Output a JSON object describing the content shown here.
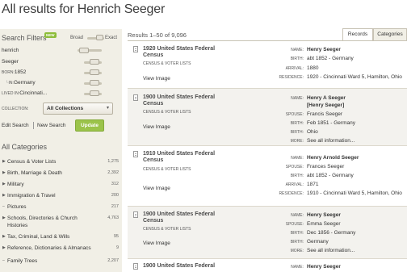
{
  "page": {
    "title": "All results for Henrich Seeger"
  },
  "sidebar": {
    "filters_title": "Search Filters",
    "new_badge": "NEW",
    "broad_label": "Broad",
    "exact_label": "Exact",
    "first_name": "henrich",
    "last_name": "Seeger",
    "born_label": "BORN:",
    "born_value": "1852",
    "born_in_label": "IN:",
    "born_in_value": "Germany",
    "lived_label": "LIVED IN:",
    "lived_value": "Cincinnati...",
    "collection_label": "COLLECTION:",
    "collection_value": "All Collections",
    "edit_search": "Edit Search",
    "new_search": "New Search",
    "update": "Update",
    "categories_title": "All Categories",
    "categories": [
      {
        "label": "Census & Voter Lists",
        "count": "1,275",
        "expandable": true
      },
      {
        "label": "Birth, Marriage & Death",
        "count": "2,392",
        "expandable": true
      },
      {
        "label": "Military",
        "count": "312",
        "expandable": true
      },
      {
        "label": "Immigration & Travel",
        "count": "200",
        "expandable": true
      },
      {
        "label": "Pictures",
        "count": "217",
        "expandable": false
      },
      {
        "label": "Schools, Directories & Church Histories",
        "count": "4,763",
        "expandable": true
      },
      {
        "label": "Tax, Criminal, Land & Wills",
        "count": "95",
        "expandable": true
      },
      {
        "label": "Reference, Dictionaries & Almanacs",
        "count": "9",
        "expandable": true
      },
      {
        "label": "Family Trees",
        "count": "2,207",
        "expandable": false
      }
    ]
  },
  "main": {
    "results_count": "Results 1–50 of 9,096",
    "tabs": {
      "records": "Records",
      "categories": "Categories"
    },
    "records": [
      {
        "title_line1": "1920 United States Federal",
        "title_line2": "Census",
        "subtitle": "CENSUS & VOTER LISTS",
        "view": "View Image",
        "fields": [
          {
            "label": "NAME:",
            "value": "Henry Seeger"
          },
          {
            "label": "BIRTH:",
            "value": "abt 1852 - Germany"
          },
          {
            "label": "ARRIVAL:",
            "value": "1880"
          },
          {
            "label": "RESIDENCE:",
            "value": "1920 - Cincinnati Ward 5, Hamilton, Ohio"
          }
        ]
      },
      {
        "title_line1": "1900 United States Federal",
        "title_line2": "Census",
        "subtitle": "CENSUS & VOTER LISTS",
        "view": "View Image",
        "fields": [
          {
            "label": "NAME:",
            "value": "Henry A Seeger"
          },
          {
            "label": "",
            "value": "[Henry Seeger]"
          },
          {
            "label": "SPOUSE:",
            "value": "Francis Seeger"
          },
          {
            "label": "BIRTH:",
            "value": "Feb 1851 - Germany"
          },
          {
            "label": "BIRTH:",
            "value": "Ohio"
          },
          {
            "label": "MORE:",
            "value": "See all information..."
          }
        ]
      },
      {
        "title_line1": "1910 United States Federal",
        "title_line2": "Census",
        "subtitle": "CENSUS & VOTER LISTS",
        "view": "View Image",
        "fields": [
          {
            "label": "NAME:",
            "value": "Henry Arnold Seeger"
          },
          {
            "label": "SPOUSE:",
            "value": "Frances Seeger"
          },
          {
            "label": "BIRTH:",
            "value": "abt 1852 - Germany"
          },
          {
            "label": "ARRIVAL:",
            "value": "1871"
          },
          {
            "label": "RESIDENCE:",
            "value": "1910 - Cincinnati Ward 5, Hamilton, Ohio"
          }
        ]
      },
      {
        "title_line1": "1900 United States Federal",
        "title_line2": "Census",
        "subtitle": "CENSUS & VOTER LISTS",
        "view": "View Image",
        "fields": [
          {
            "label": "NAME:",
            "value": "Henry Seeger"
          },
          {
            "label": "SPOUSE:",
            "value": "Emma Seeger"
          },
          {
            "label": "BIRTH:",
            "value": "Dec 1856 - Germany"
          },
          {
            "label": "BIRTH:",
            "value": "Germany"
          },
          {
            "label": "MORE:",
            "value": "See all information..."
          }
        ]
      },
      {
        "title_line1": "1900 United States Federal",
        "fields": [
          {
            "label": "NAME:",
            "value": "Henry Seeger"
          }
        ]
      }
    ]
  }
}
